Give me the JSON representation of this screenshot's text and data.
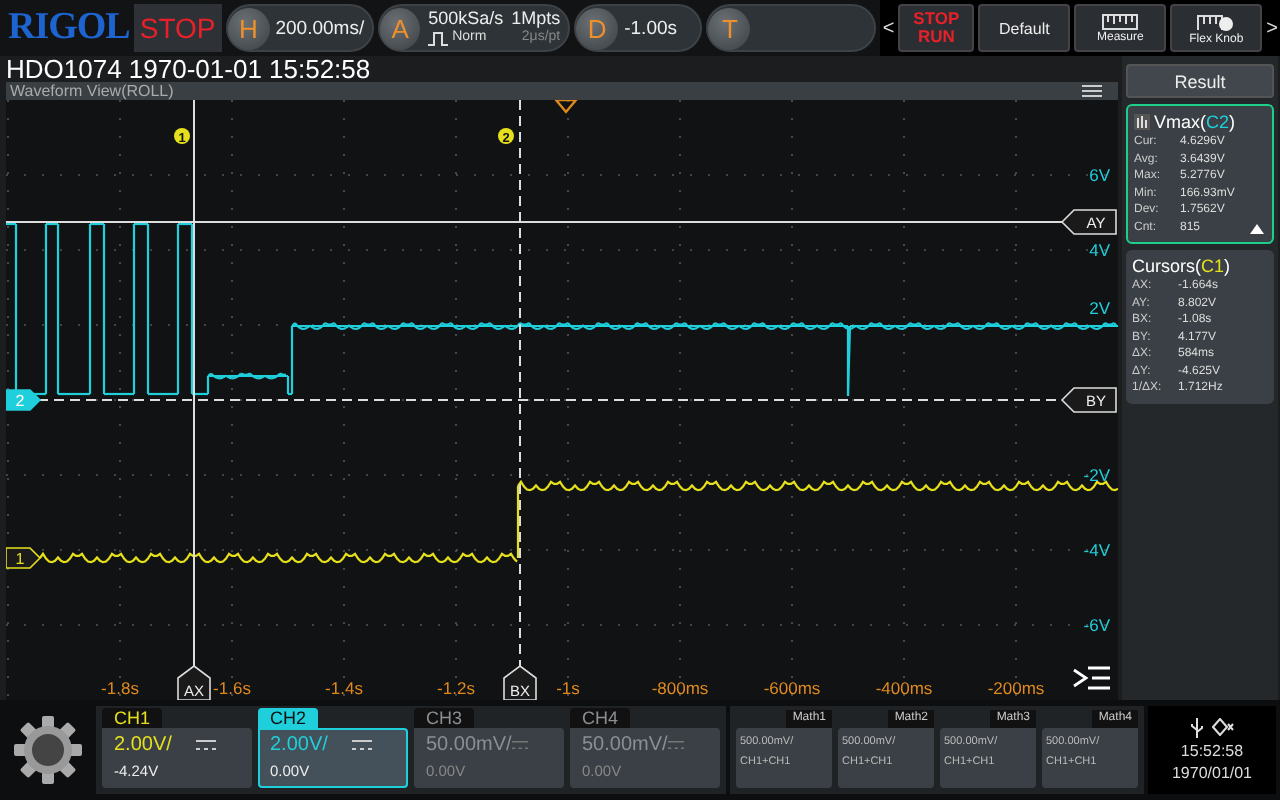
{
  "top_bar": {
    "logo": "RIGOL",
    "run_state": "STOP",
    "horizontal": {
      "key": "H",
      "timebase": "200.00ms/"
    },
    "acquire": {
      "key": "A",
      "sample_rate": "500kSa/s",
      "mode": "Norm",
      "memory_depth": "1Mpts",
      "resolution": "2μs/pt"
    },
    "delay": {
      "key": "D",
      "value": "-1.00s"
    },
    "trigger": {
      "key": "T"
    },
    "buttons": [
      {
        "kind": "arrow",
        "label": "<"
      },
      {
        "kind": "stoprun",
        "lines": [
          "STOP",
          "RUN"
        ]
      },
      {
        "kind": "text",
        "label": "Default"
      },
      {
        "kind": "ruler",
        "label": "Measure"
      },
      {
        "kind": "knob",
        "label": "Flex Knob"
      },
      {
        "kind": "arrow",
        "label": ">"
      }
    ]
  },
  "title": "HDO1074 1970-01-01 15:52:58",
  "view_label": "Waveform View(ROLL)",
  "waveform": {
    "x_ticks": [
      "-1.8s",
      "-1.6s",
      "-1.4s",
      "-1.2s",
      "-1s",
      "-800ms",
      "-600ms",
      "-400ms",
      "-200ms"
    ],
    "y_ticks": [
      "6V",
      "4V",
      "2V",
      "-2V",
      "-4V",
      "-6V"
    ],
    "cursor_markers": [
      "1",
      "2"
    ],
    "x_cursors": [
      "AX",
      "BX"
    ],
    "y_cursors": [
      "AY",
      "BY"
    ],
    "channel_markers": [
      {
        "label": "2",
        "color": "#1fd0dc"
      },
      {
        "label": "1",
        "color": "#e6e01c"
      }
    ]
  },
  "results": {
    "header": "Result",
    "measure": {
      "title": "Vmax(",
      "source": "C2",
      "title_end": ")",
      "rows": [
        {
          "label": "Cur:",
          "value": "4.6296V"
        },
        {
          "label": "Avg:",
          "value": "3.6439V"
        },
        {
          "label": "Max:",
          "value": "5.2776V"
        },
        {
          "label": "Min:",
          "value": "166.93mV"
        },
        {
          "label": "Dev:",
          "value": "1.7562V"
        },
        {
          "label": "Cnt:",
          "value": "815"
        }
      ]
    },
    "cursors": {
      "title": "Cursors(",
      "source": "C1",
      "title_end": ")",
      "rows": [
        {
          "label": "AX:",
          "value": "-1.664s"
        },
        {
          "label": "AY:",
          "value": "8.802V"
        },
        {
          "label": "BX:",
          "value": "-1.08s"
        },
        {
          "label": "BY:",
          "value": "4.177V"
        },
        {
          "label": "ΔX:",
          "value": "584ms"
        },
        {
          "label": "ΔY:",
          "value": "-4.625V"
        },
        {
          "label": "1/ΔX:",
          "value": "1.712Hz"
        }
      ]
    }
  },
  "channels": [
    {
      "name": "CH1",
      "scale": "2.00V/",
      "offset": "-4.24V",
      "color": "#e6e01c",
      "enabled": true,
      "selected": false
    },
    {
      "name": "CH2",
      "scale": "2.00V/",
      "offset": "0.00V",
      "color": "#1fd0dc",
      "enabled": true,
      "selected": true
    },
    {
      "name": "CH3",
      "scale": "50.00mV/",
      "offset": "0.00V",
      "color": "#8a8f94",
      "enabled": false,
      "selected": false
    },
    {
      "name": "CH4",
      "scale": "50.00mV/",
      "offset": "0.00V",
      "color": "#8a8f94",
      "enabled": false,
      "selected": false
    }
  ],
  "maths": [
    {
      "name": "Math1",
      "scale": "500.00mV/",
      "source": "CH1+CH1"
    },
    {
      "name": "Math2",
      "scale": "500.00mV/",
      "source": "CH1+CH1"
    },
    {
      "name": "Math3",
      "scale": "500.00mV/",
      "source": "CH1+CH1"
    },
    {
      "name": "Math4",
      "scale": "500.00mV/",
      "source": "CH1+CH1"
    }
  ],
  "status": {
    "time": "15:52:58",
    "date": "1970/01/01"
  }
}
